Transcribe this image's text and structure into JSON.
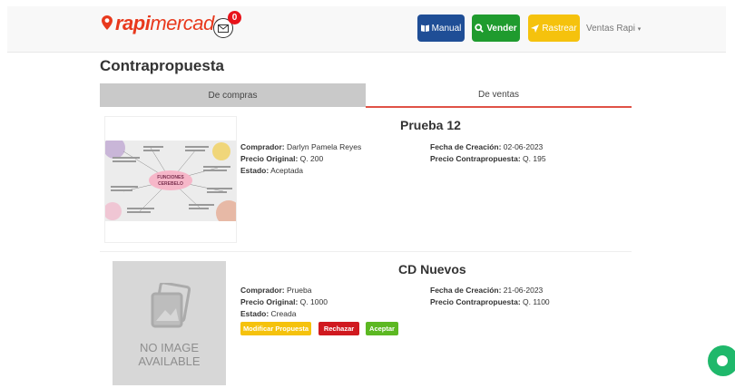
{
  "header": {
    "logo_rapi": "rapi",
    "logo_mercado": "mercado",
    "mail_badge_count": "0",
    "btn_manual": "Manual",
    "btn_vender": "Vender",
    "btn_rastrear": "Rastrear",
    "user_menu": "Ventas Rapi"
  },
  "page": {
    "title": "Contrapropuesta",
    "tabs": [
      "De compras",
      "De ventas"
    ],
    "active_tab": "De ventas"
  },
  "offers": [
    {
      "title": "Prueba 12",
      "comprador_label": "Comprador:",
      "comprador": "Darlyn Pamela Reyes",
      "precio_original_label": "Precio Original:",
      "precio_original": "Q. 200",
      "estado_label": "Estado:",
      "estado": "Aceptada",
      "fecha_label": "Fecha de Creación:",
      "fecha": "02-06-2023",
      "precio_contra_label": "Precio Contrapropuesta:",
      "precio_contra": "Q. 195",
      "image_text": "FUNCIONES CEREBELO"
    },
    {
      "title": "CD Nuevos",
      "comprador_label": "Comprador:",
      "comprador": "Prueba",
      "precio_original_label": "Precio Original:",
      "precio_original": "Q. 1000",
      "estado_label": "Estado:",
      "estado": "Creada",
      "fecha_label": "Fecha de Creación:",
      "fecha": "21-06-2023",
      "precio_contra_label": "Precio Contrapropuesta:",
      "precio_contra": "Q. 1100",
      "no_image_line1": "NO IMAGE",
      "no_image_line2": "AVAILABLE",
      "actions": [
        "Modificar Propuesta",
        "Rechazar",
        "Aceptar"
      ]
    }
  ],
  "colors": {
    "brand": "#e8391d",
    "manual": "#1f4e96",
    "vender": "#1f9b2e",
    "rastrear": "#f5c20d",
    "rechazar": "#d0191f",
    "aceptar": "#5cb822",
    "chat": "#1fb86b"
  }
}
